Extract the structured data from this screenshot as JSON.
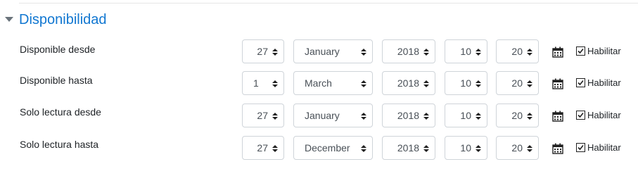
{
  "section": {
    "title": "Disponibilidad",
    "icon": "caret-down-icon"
  },
  "colors": {
    "accent": "#1177d1",
    "text": "#1d2125",
    "border": "#cfd4d9"
  },
  "rows": [
    {
      "label": "Disponible desde",
      "day": "27",
      "month": "January",
      "year": "2018",
      "hour": "10",
      "minute": "20",
      "enable_label": "Habilitar",
      "enabled": true
    },
    {
      "label": "Disponible hasta",
      "day": "1",
      "month": "March",
      "year": "2018",
      "hour": "10",
      "minute": "20",
      "enable_label": "Habilitar",
      "enabled": true
    },
    {
      "label": "Solo lectura desde",
      "day": "27",
      "month": "January",
      "year": "2018",
      "hour": "10",
      "minute": "20",
      "enable_label": "Habilitar",
      "enabled": true
    },
    {
      "label": "Solo lectura hasta",
      "day": "27",
      "month": "December",
      "year": "2018",
      "hour": "10",
      "minute": "20",
      "enable_label": "Habilitar",
      "enabled": true
    }
  ]
}
